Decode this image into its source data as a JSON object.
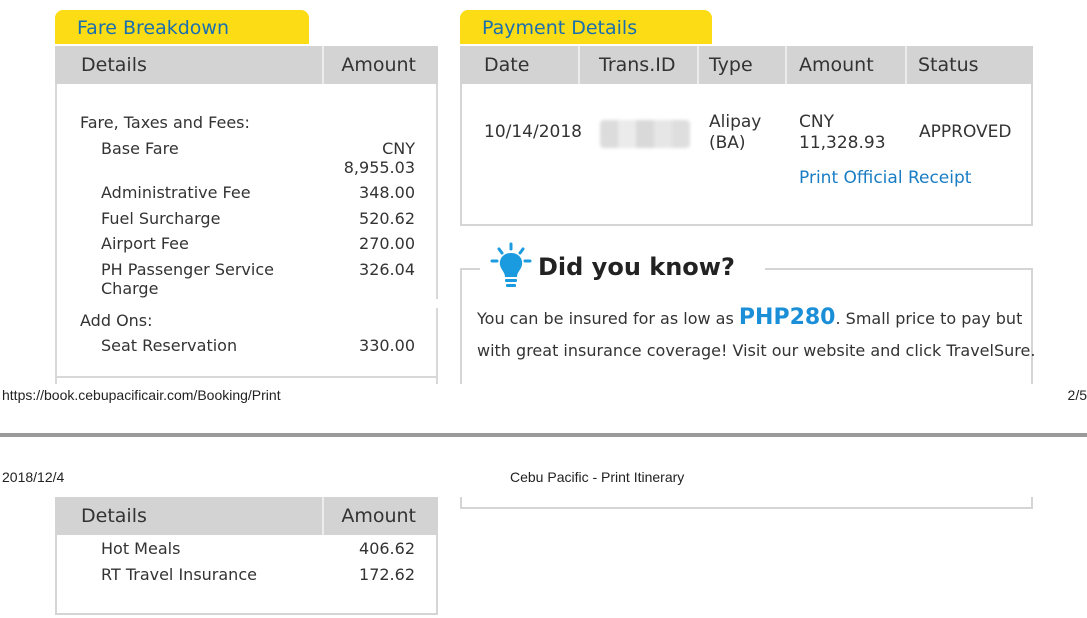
{
  "fare": {
    "tab_title": "Fare Breakdown",
    "col_details": "Details",
    "col_amount": "Amount",
    "section_fare": "Fare, Taxes and Fees:",
    "items": [
      {
        "label": "Base Fare",
        "amount_line1": "CNY",
        "amount_line2": "8,955.03"
      },
      {
        "label": "Administrative Fee",
        "amount": "348.00"
      },
      {
        "label": "Fuel Surcharge",
        "amount": "520.62"
      },
      {
        "label": "Airport Fee",
        "amount": "270.00"
      },
      {
        "label_line1": "PH Passenger Service",
        "label_line2": "Charge",
        "amount": "326.04"
      }
    ],
    "section_addons": "Add Ons:",
    "addons": [
      {
        "label": "Seat Reservation",
        "amount": "330.00"
      }
    ]
  },
  "payment": {
    "tab_title": "Payment Details",
    "cols": [
      "Date",
      "Trans.ID",
      "Type",
      "Amount",
      "Status"
    ],
    "row": {
      "date": "10/14/2018",
      "type_line1": "Alipay",
      "type_line2": "(BA)",
      "amount_line1": "CNY",
      "amount_line2": "11,328.93",
      "status": "APPROVED"
    },
    "receipt_link": "Print Official Receipt"
  },
  "did_you_know": {
    "title": "Did you know?",
    "text_before": "You can be insured for as low as ",
    "highlight": "PHP280",
    "text_after": ". Small price to pay but",
    "line2": "with great insurance coverage! Visit our website and click TravelSure.",
    "icon": "lightbulb-icon",
    "icon_color": "#1a9be0"
  },
  "print_footer": {
    "url": "https://book.cebupacificair.com/Booking/Print",
    "page": "2/5"
  },
  "print_header": {
    "date": "2018/12/4",
    "title": "Cebu Pacific - Print Itinerary"
  },
  "fare_cont": {
    "col_details": "Details",
    "col_amount": "Amount",
    "items": [
      {
        "label": "Hot Meals",
        "amount": "406.62"
      },
      {
        "label": "RT Travel Insurance",
        "amount": "172.62"
      }
    ]
  },
  "colors": {
    "tab_bg": "#fcdc14",
    "tab_text": "#1a6fb0",
    "header_bg": "#d3d3d3",
    "link": "#1a7dc3"
  }
}
